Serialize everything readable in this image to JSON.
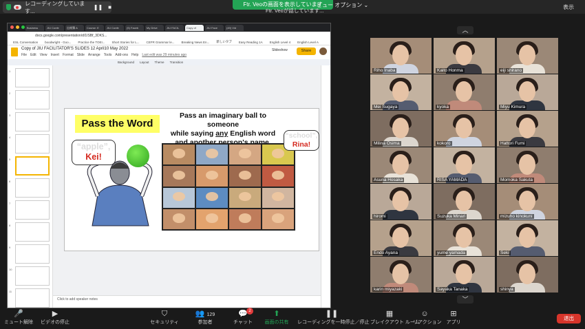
{
  "recording_bar": {
    "text": "レコーディングしています...",
    "pause": "❚❚",
    "stop": "■"
  },
  "share_banner": "Ftr. Veoの画面を表示しています",
  "share_notice": "Ftr. Veoが話しています...",
  "view_options": "ビュー オプション ⌄",
  "display_label": "表示",
  "browser": {
    "tabs": [
      "Business",
      "JIU Confe",
      "出席簿 A",
      "Course: E",
      "JIU Confe",
      "(5) Faceb",
      "My Drive",
      "JIU FACIL",
      "Copy of",
      "JIU Face",
      "(49) Vid"
    ],
    "active_tab_index": 8,
    "url": "docs.google.com/presentation/d/1ISBf_3DKS...",
    "bookmarks": [
      "ESL Conversation",
      "boodwright - Goo...",
      "Practice the TOEI...",
      "Short Stories for L...",
      "CEFR Grammar le...",
      "Breaking News En...",
      "新しいタブ",
      "Easy Reading 1A",
      "English Level 4",
      "English Level A"
    ]
  },
  "slides_app": {
    "title": "Copy of JIU FACILITATOR'S SLIDES 12 April10 May 2022",
    "menu": [
      "File",
      "Edit",
      "View",
      "Insert",
      "Format",
      "Slide",
      "Arrange",
      "Tools",
      "Add-ons",
      "Help"
    ],
    "last_edit": "Last edit was 29 minutes ago",
    "slideshow_label": "Slideshow",
    "share_label": "Share",
    "toolbar_items": [
      "Background",
      "Layout",
      "Theme",
      "Transition"
    ],
    "speaker_notes_placeholder": "Click to add speaker notes",
    "thumbnail_numbers": [
      "1",
      "2",
      "3",
      "4",
      "5",
      "6",
      "7",
      "8",
      "9",
      "10",
      "11"
    ],
    "selected_thumbnail": 4
  },
  "slide": {
    "title": "Pass the Word",
    "instruction_line1": "Pass an imaginary ball to someone",
    "instruction_line2_pre": "while saying ",
    "instruction_line2_em": "any",
    "instruction_line2_post": " English word",
    "instruction_line3": "and another person's name.",
    "bubble_left_word": "“apple”,",
    "bubble_left_name": "Kei!",
    "bubble_right_word": "“school”,",
    "bubble_right_name": "Rina!"
  },
  "participants": [
    "Riho Inaba",
    "Kaito Honma",
    "eiji shirano",
    "Mei Sugaya",
    "kyoka",
    "Miyu Kimura",
    "Milina Osima",
    "kokoro",
    "Hattori Fumi",
    "Asuna Hosaka",
    "RISA YAMADA",
    "Momoka Sakuta",
    "hiromi",
    "Suzuka Minari",
    "mizuho kinokuni",
    "Endo Ayana",
    "yume yamada",
    "Seki",
    "karin miyazaki",
    "Sayaka Tanaka",
    "shinya"
  ],
  "bottom_bar": {
    "mute": "ミュート解除",
    "video": "ビデオの停止",
    "security": "セキュリティ",
    "participants": "参加者",
    "participants_count": "129",
    "chat": "チャット",
    "chat_badge": "2",
    "share_screen": "画面の共有",
    "pause_recording": "レコーディングを一時停止／停止",
    "breakout": "ブレイクアウト ルーム",
    "reactions": "リアクション",
    "apps": "アプリ",
    "end": "退出"
  }
}
